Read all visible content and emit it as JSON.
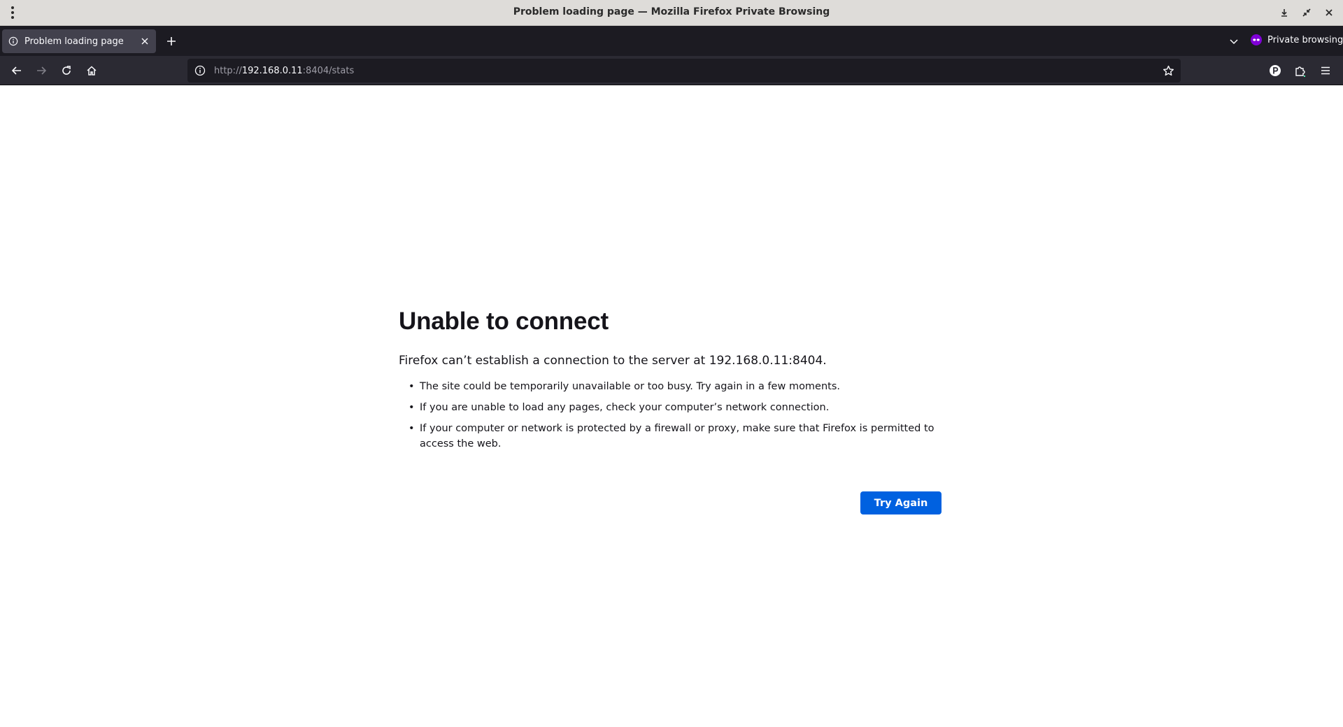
{
  "window": {
    "title": "Problem loading page — Mozilla Firefox Private Browsing"
  },
  "tabs": [
    {
      "title": "Problem loading page",
      "icon": "info-icon",
      "active": true
    }
  ],
  "private_indicator": {
    "label": "Private browsing",
    "icon": "private-mask-icon",
    "color": "#8000d7"
  },
  "urlbar": {
    "scheme": "http://",
    "host": "192.168.0.11",
    "tail": ":8404/stats"
  },
  "error": {
    "title": "Unable to connect",
    "description": "Firefox can’t establish a connection to the server at 192.168.0.11:8404.",
    "items": [
      "The site could be temporarily unavailable or too busy. Try again in a few moments.",
      "If you are unable to load any pages, check your computer’s network connection.",
      "If your computer or network is protected by a firewall or proxy, make sure that Firefox is permitted to access the web."
    ],
    "button_label": "Try Again",
    "button_color": "#0061e0"
  }
}
